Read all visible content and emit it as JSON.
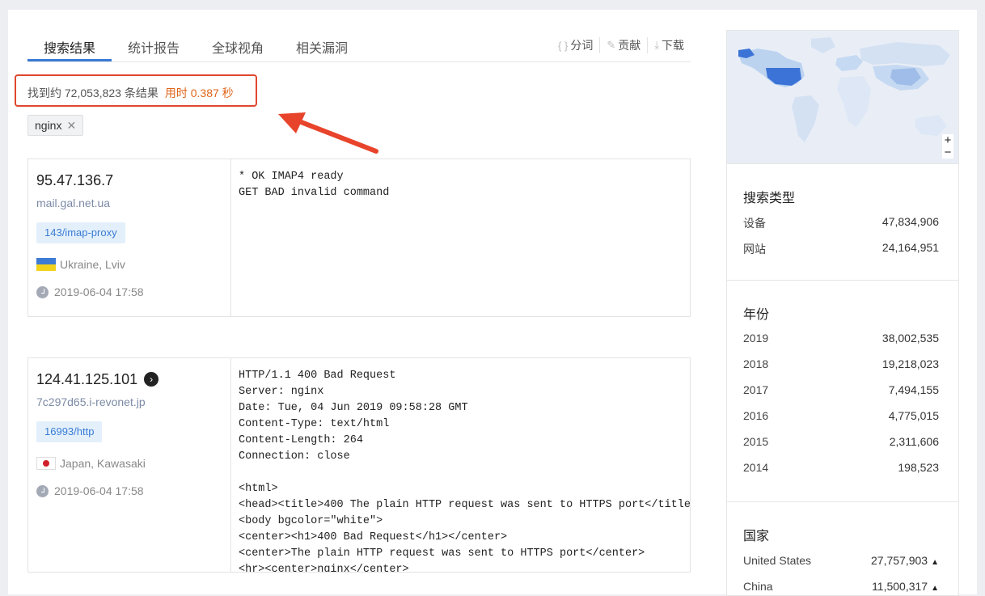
{
  "tabs": [
    "搜索结果",
    "统计报告",
    "全球视角",
    "相关漏洞"
  ],
  "actions": [
    {
      "icon": "braces-icon",
      "label": "分词"
    },
    {
      "icon": "edit-icon",
      "label": "贡献"
    },
    {
      "icon": "download-icon",
      "label": "下载"
    }
  ],
  "summary": {
    "text": "找到约 72,053,823 条结果",
    "time": "用时 0.387 秒"
  },
  "filter_chip": "nginx",
  "results": [
    {
      "ip": "95.47.136.7",
      "host": "mail.gal.net.ua",
      "port": "143/imap-proxy",
      "location": "Ukraine, Lviv",
      "date": "2019-06-04 17:58",
      "banner": "* OK IMAP4 ready\nGET BAD invalid command"
    },
    {
      "ip": "124.41.125.101",
      "host": "7c297d65.i-revonet.jp",
      "port": "16993/http",
      "location": "Japan, Kawasaki",
      "date": "2019-06-04 17:58",
      "banner": "HTTP/1.1 400 Bad Request\nServer: nginx\nDate: Tue, 04 Jun 2019 09:58:28 GMT\nContent-Type: text/html\nContent-Length: 264\nConnection: close\n\n<html>\n<head><title>400 The plain HTTP request was sent to HTTPS port</title></head>\n<body bgcolor=\"white\">\n<center><h1>400 Bad Request</h1></center>\n<center>The plain HTTP request was sent to HTTPS port</center>\n<hr><center>nginx</center>"
    }
  ],
  "sidebar": {
    "map": {
      "zoom_in": "+",
      "zoom_out": "−"
    },
    "search_type": {
      "title": "搜索类型",
      "rows": [
        {
          "k": "设备",
          "v": "47,834,906"
        },
        {
          "k": "网站",
          "v": "24,164,951"
        }
      ]
    },
    "year": {
      "title": "年份",
      "rows": [
        {
          "k": "2019",
          "v": "38,002,535"
        },
        {
          "k": "2018",
          "v": "19,218,023"
        },
        {
          "k": "2017",
          "v": "7,494,155"
        },
        {
          "k": "2016",
          "v": "4,775,015"
        },
        {
          "k": "2015",
          "v": "2,311,606"
        },
        {
          "k": "2014",
          "v": "198,523"
        }
      ]
    },
    "country": {
      "title": "国家",
      "rows": [
        {
          "k": "United States",
          "v": "27,757,903"
        },
        {
          "k": "China",
          "v": "11,500,317"
        }
      ]
    }
  },
  "colors": {
    "accent": "#3a7bd5",
    "highlight_box": "#e0472e",
    "time_text": "#e0661a",
    "map_top": "#3b73d6",
    "map_light": "#bcd3f0"
  }
}
